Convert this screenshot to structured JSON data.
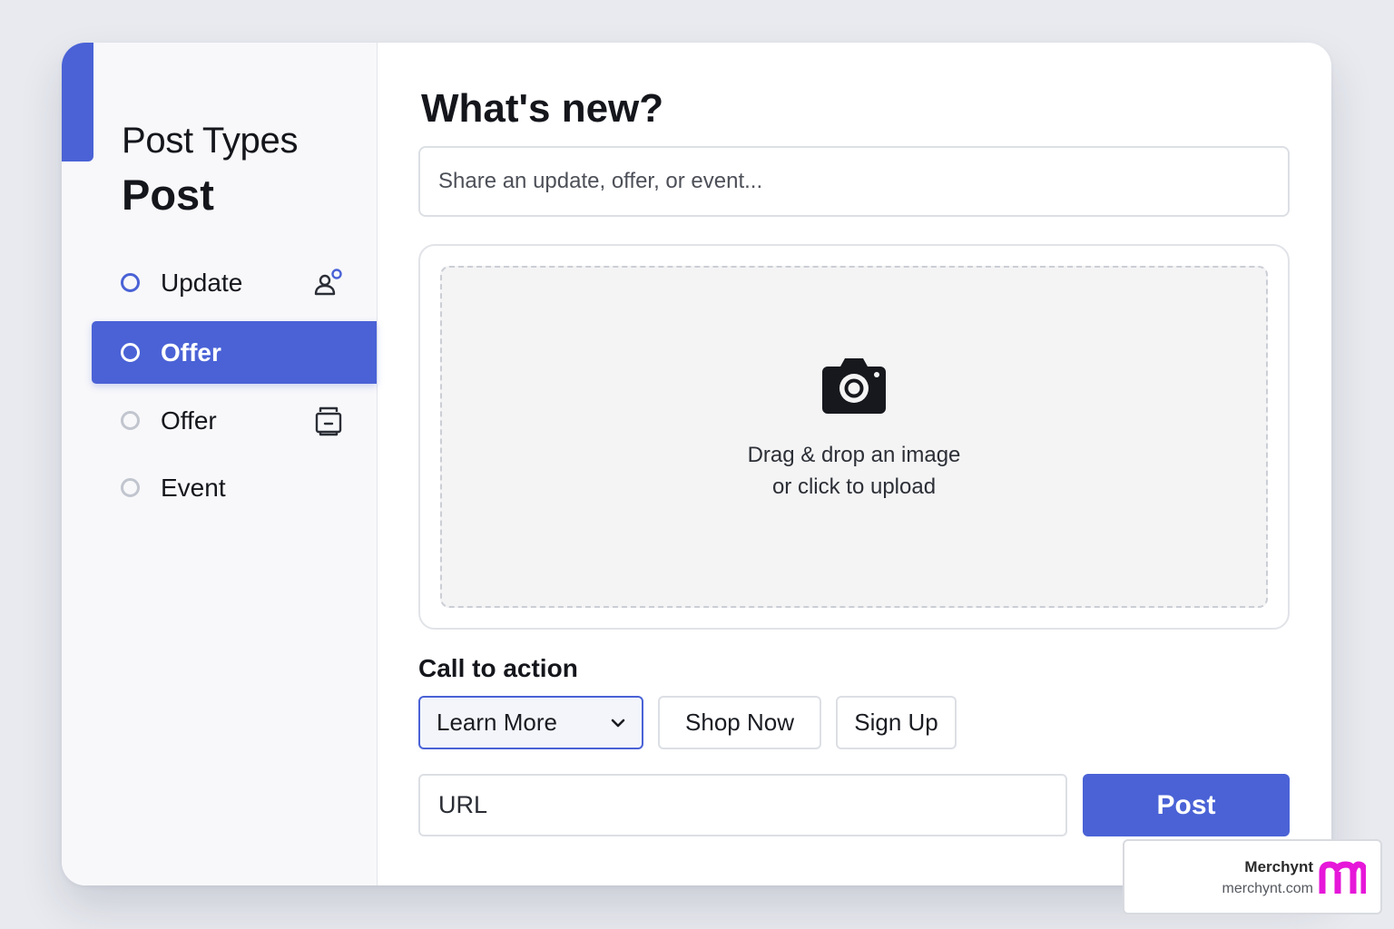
{
  "sidebar": {
    "title": "Post Types",
    "subtitle": "Post",
    "items": [
      {
        "label": "Update",
        "icon": "person-add-icon",
        "selected": false
      },
      {
        "label": "Offer",
        "icon": null,
        "selected": true
      },
      {
        "label": "Offer",
        "icon": "tablet-frame-icon",
        "selected": false
      },
      {
        "label": "Event",
        "icon": null,
        "selected": false
      }
    ]
  },
  "main": {
    "heading": "What's new?",
    "input_placeholder": "Share an update, offer, or event...",
    "upload": {
      "icon": "camera-icon",
      "line1": "Drag & drop an image",
      "line2": "or click to upload"
    },
    "cta": {
      "label": "Call to action",
      "selected": "Learn More",
      "options": [
        "Shop Now",
        "Sign Up"
      ]
    },
    "url_placeholder": "URL",
    "post_button": "Post"
  },
  "brand": {
    "name": "Merchynt",
    "url": "merchynt.com",
    "logo_letter": "m"
  },
  "colors": {
    "accent": "#4a62d6",
    "brand_magenta": "#e617d9",
    "background": "#e8eaef"
  }
}
